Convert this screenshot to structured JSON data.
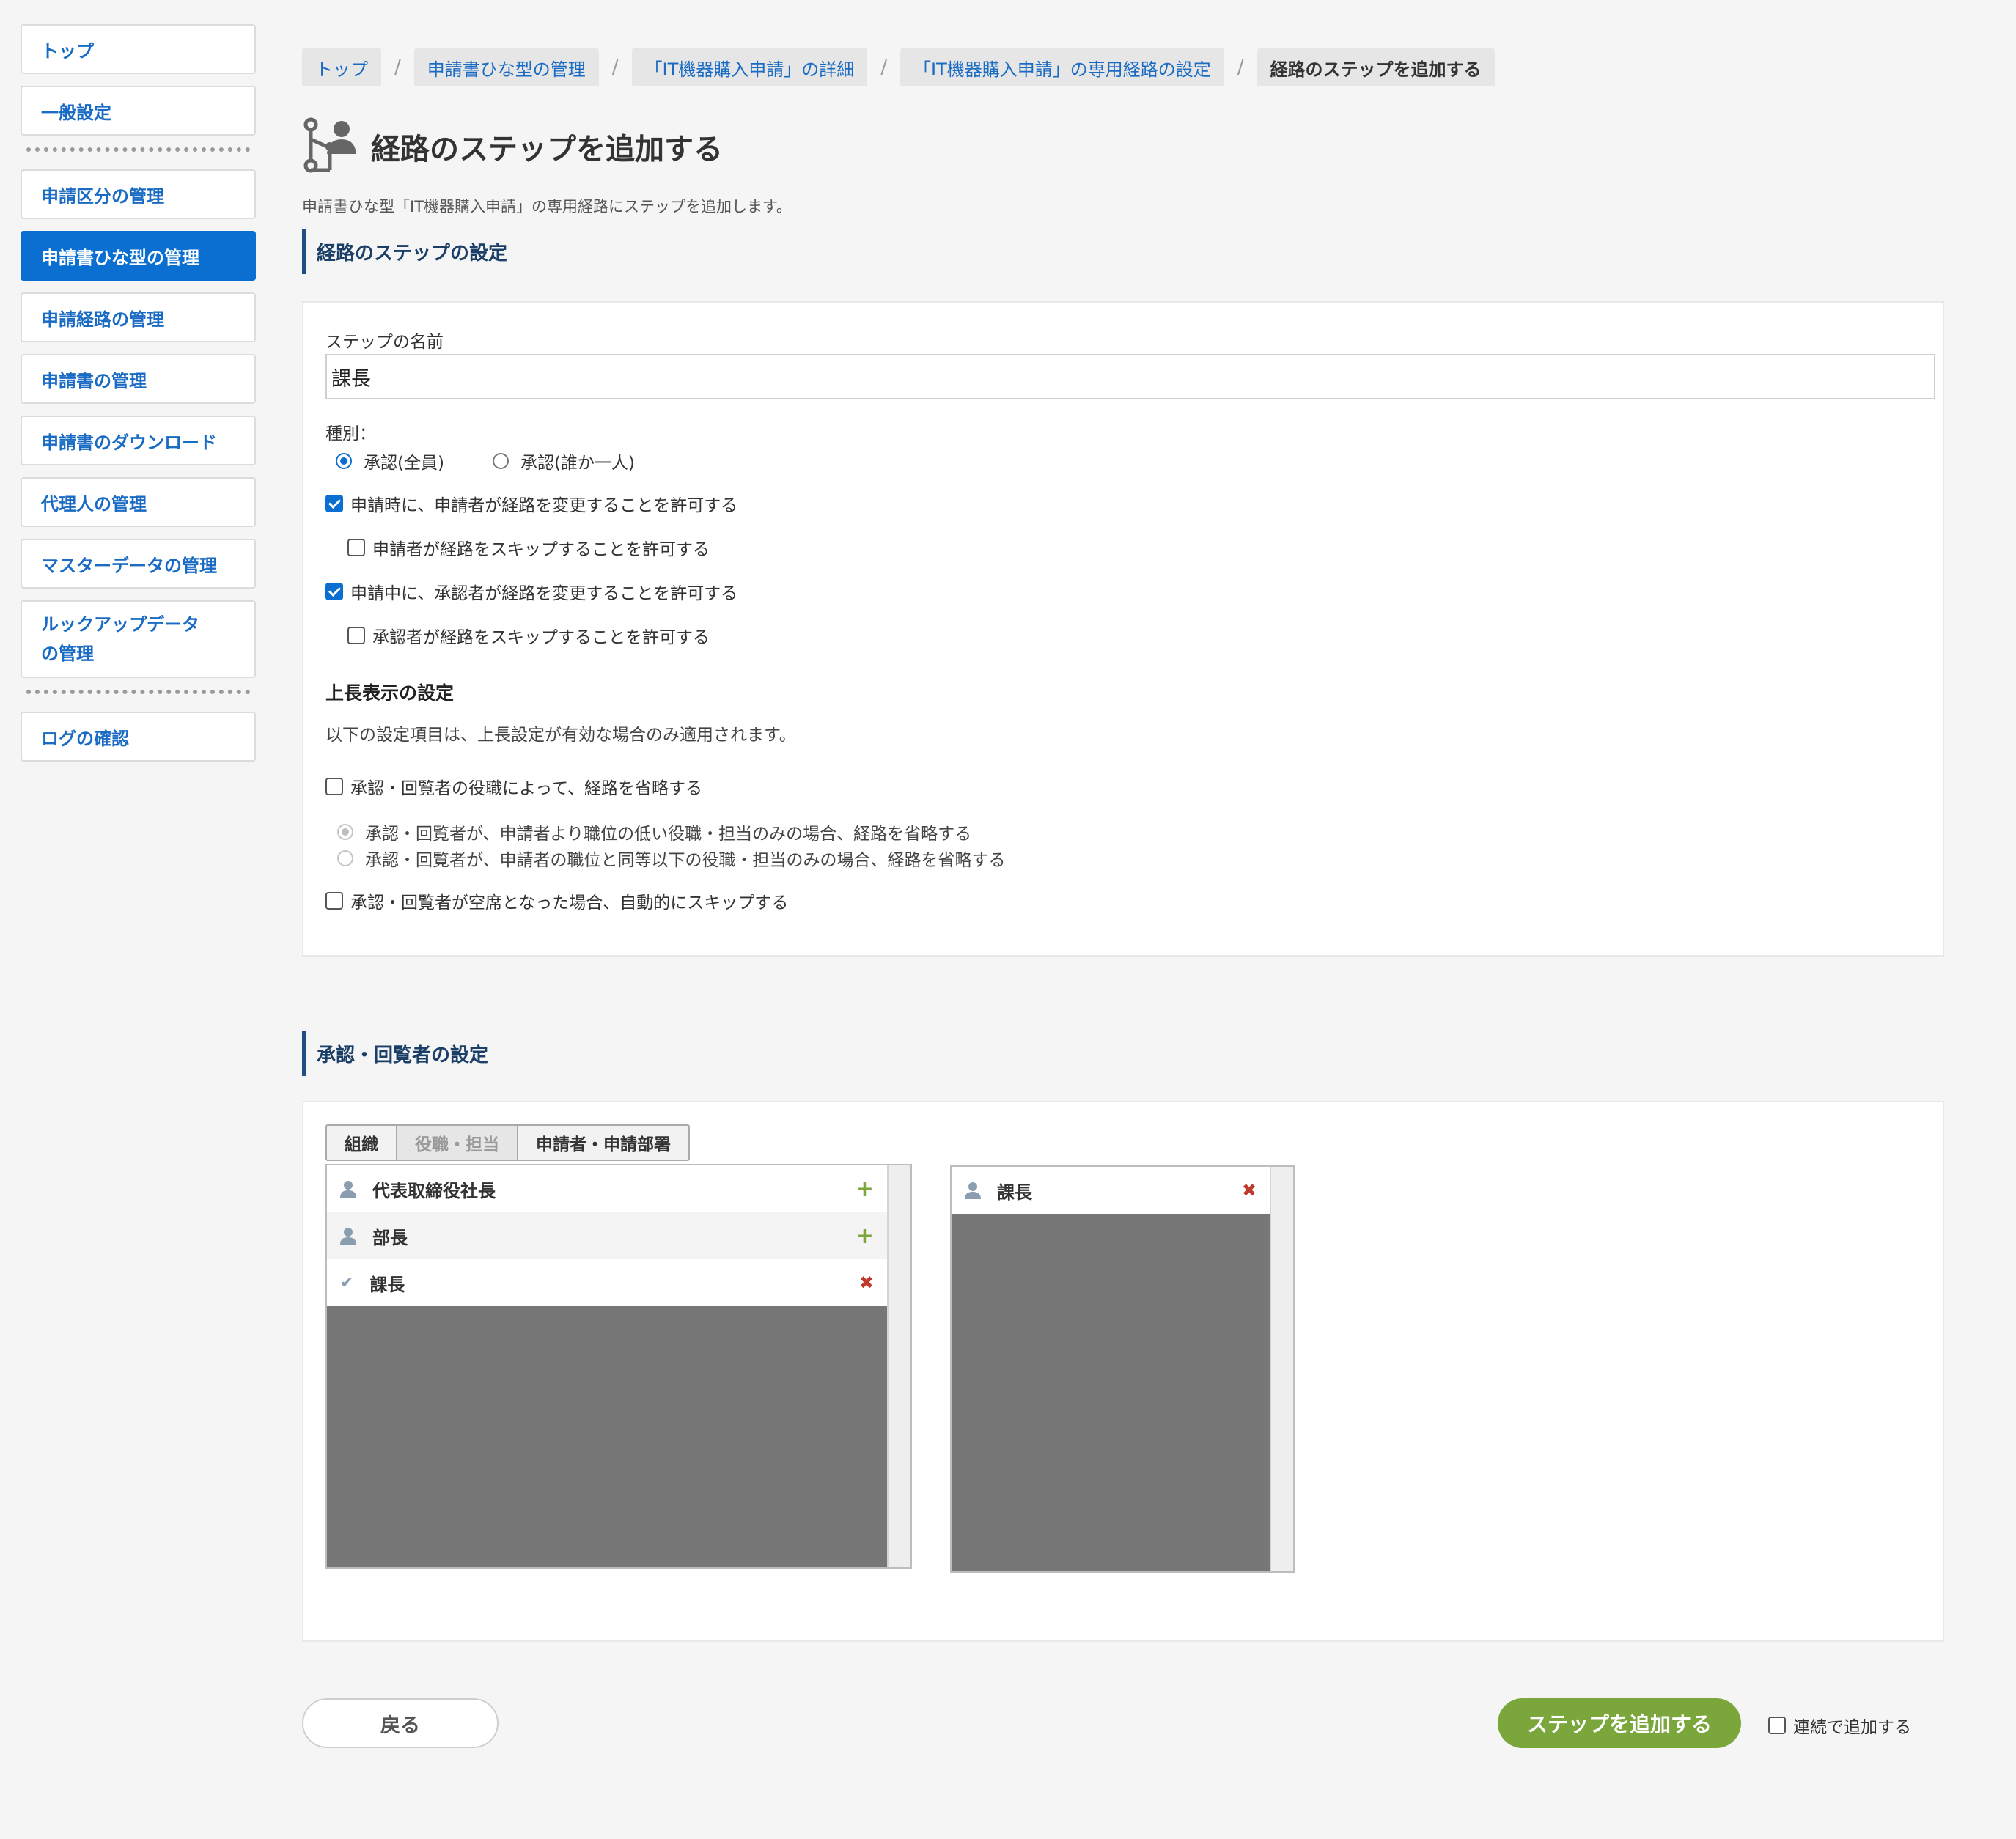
{
  "sidebar": {
    "items": [
      {
        "label": "トップ"
      },
      {
        "label": "一般設定"
      },
      {
        "label": "申請区分の管理"
      },
      {
        "label": "申請書ひな型の管理"
      },
      {
        "label": "申請経路の管理"
      },
      {
        "label": "申請書の管理"
      },
      {
        "label": "申請書のダウンロード"
      },
      {
        "label": "代理人の管理"
      },
      {
        "label": "マスターデータの管理"
      },
      {
        "label": "ルックアップデータの管理"
      },
      {
        "label": "ログの確認"
      }
    ],
    "active_item": "申請書ひな型の管理",
    "accent_color": "#0a6fd0"
  },
  "breadcrumb": [
    {
      "label": "トップ"
    },
    {
      "label": "申請書ひな型の管理"
    },
    {
      "label": "「IT機器購入申請」の詳細"
    },
    {
      "label": "「IT機器購入申請」の専用経路の設定"
    },
    {
      "label": "経路のステップを追加する"
    }
  ],
  "page": {
    "title": "経路のステップを追加する",
    "description": "申請書ひな型「IT機器購入申請」の専用経路にステップを追加します。"
  },
  "step_settings": {
    "heading": "経路のステップの設定",
    "name_label": "ステップの名前",
    "name_value": "課長",
    "type_label": "種別：",
    "type_options": [
      {
        "label": "承認(全員)",
        "selected": true
      },
      {
        "label": "承認(誰か一人)",
        "selected": false
      }
    ],
    "permissions": [
      {
        "label": "申請時に、申請者が経路を変更することを許可する",
        "checked": true
      },
      {
        "label": "申請者が経路をスキップすることを許可する",
        "checked": false
      },
      {
        "label": "申請中に、承認者が経路を変更することを許可する",
        "checked": true
      },
      {
        "label": "承認者が経路をスキップすることを許可する",
        "checked": false
      }
    ],
    "superior": {
      "heading": "上長表示の設定",
      "note": "以下の設定項目は、上長設定が有効な場合のみ適用されます。",
      "omit_by_position_label": "承認・回覧者の役職によって、経路を省略する",
      "omit_by_position_checked": false,
      "omit_options": [
        {
          "label": "承認・回覧者が、申請者より職位の低い役職・担当のみの場合、経路を省略する",
          "selected": true
        },
        {
          "label": "承認・回覧者が、申請者の職位と同等以下の役職・担当のみの場合、経路を省略する",
          "selected": false
        }
      ],
      "auto_skip_label": "承認・回覧者が空席となった場合、自動的にスキップする",
      "auto_skip_checked": false
    }
  },
  "approver_settings": {
    "heading": "承認・回覧者の設定",
    "tabs": [
      {
        "label": "組織",
        "active": false
      },
      {
        "label": "役職・担当",
        "active": true
      },
      {
        "label": "申請者・申請部署",
        "active": false
      }
    ],
    "candidates": [
      {
        "label": "代表取締役社長",
        "icon": "person-icon",
        "action": "add"
      },
      {
        "label": "部長",
        "icon": "person-icon",
        "action": "add"
      },
      {
        "label": "課長",
        "icon": "check-icon",
        "action": "remove"
      }
    ],
    "selected": [
      {
        "label": "課長",
        "icon": "person-icon",
        "action": "remove"
      }
    ]
  },
  "footer": {
    "back_label": "戻る",
    "submit_label": "ステップを追加する",
    "submit_color": "#7aa63c",
    "continuous_label": "連続で追加する",
    "continuous_checked": false
  }
}
